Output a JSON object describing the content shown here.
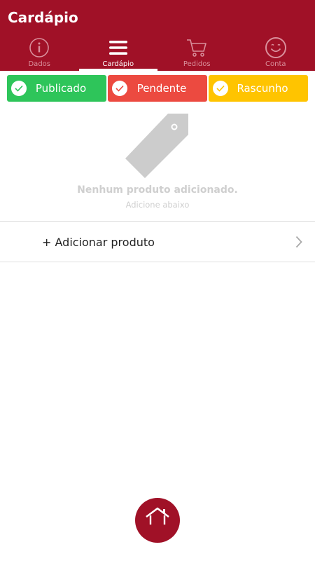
{
  "app": {
    "title": "Cardápio"
  },
  "tabs": [
    {
      "label": "Dados",
      "icon": "info-icon",
      "active": false
    },
    {
      "label": "Cardápio",
      "icon": "menu-icon",
      "active": true
    },
    {
      "label": "Pedidos",
      "icon": "cart-icon",
      "active": false
    },
    {
      "label": "Conta",
      "icon": "smiley-icon",
      "active": false
    }
  ],
  "filters": [
    {
      "label": "Publicado",
      "color": "#2ec55a",
      "checked": true
    },
    {
      "label": "Pendente",
      "color": "#ec4a40",
      "checked": true
    },
    {
      "label": "Rascunho",
      "color": "#ffc400",
      "checked": true
    }
  ],
  "empty_state": {
    "icon": "tag-icon",
    "title": "Nenhum produto adicionado.",
    "subtitle": "Adicione abaixo"
  },
  "add_product": {
    "label": "+ Adicionar produto"
  },
  "home": {
    "icon": "home-icon"
  },
  "colors": {
    "brand": "#a01127",
    "tab_inactive": "#d98f9b"
  }
}
